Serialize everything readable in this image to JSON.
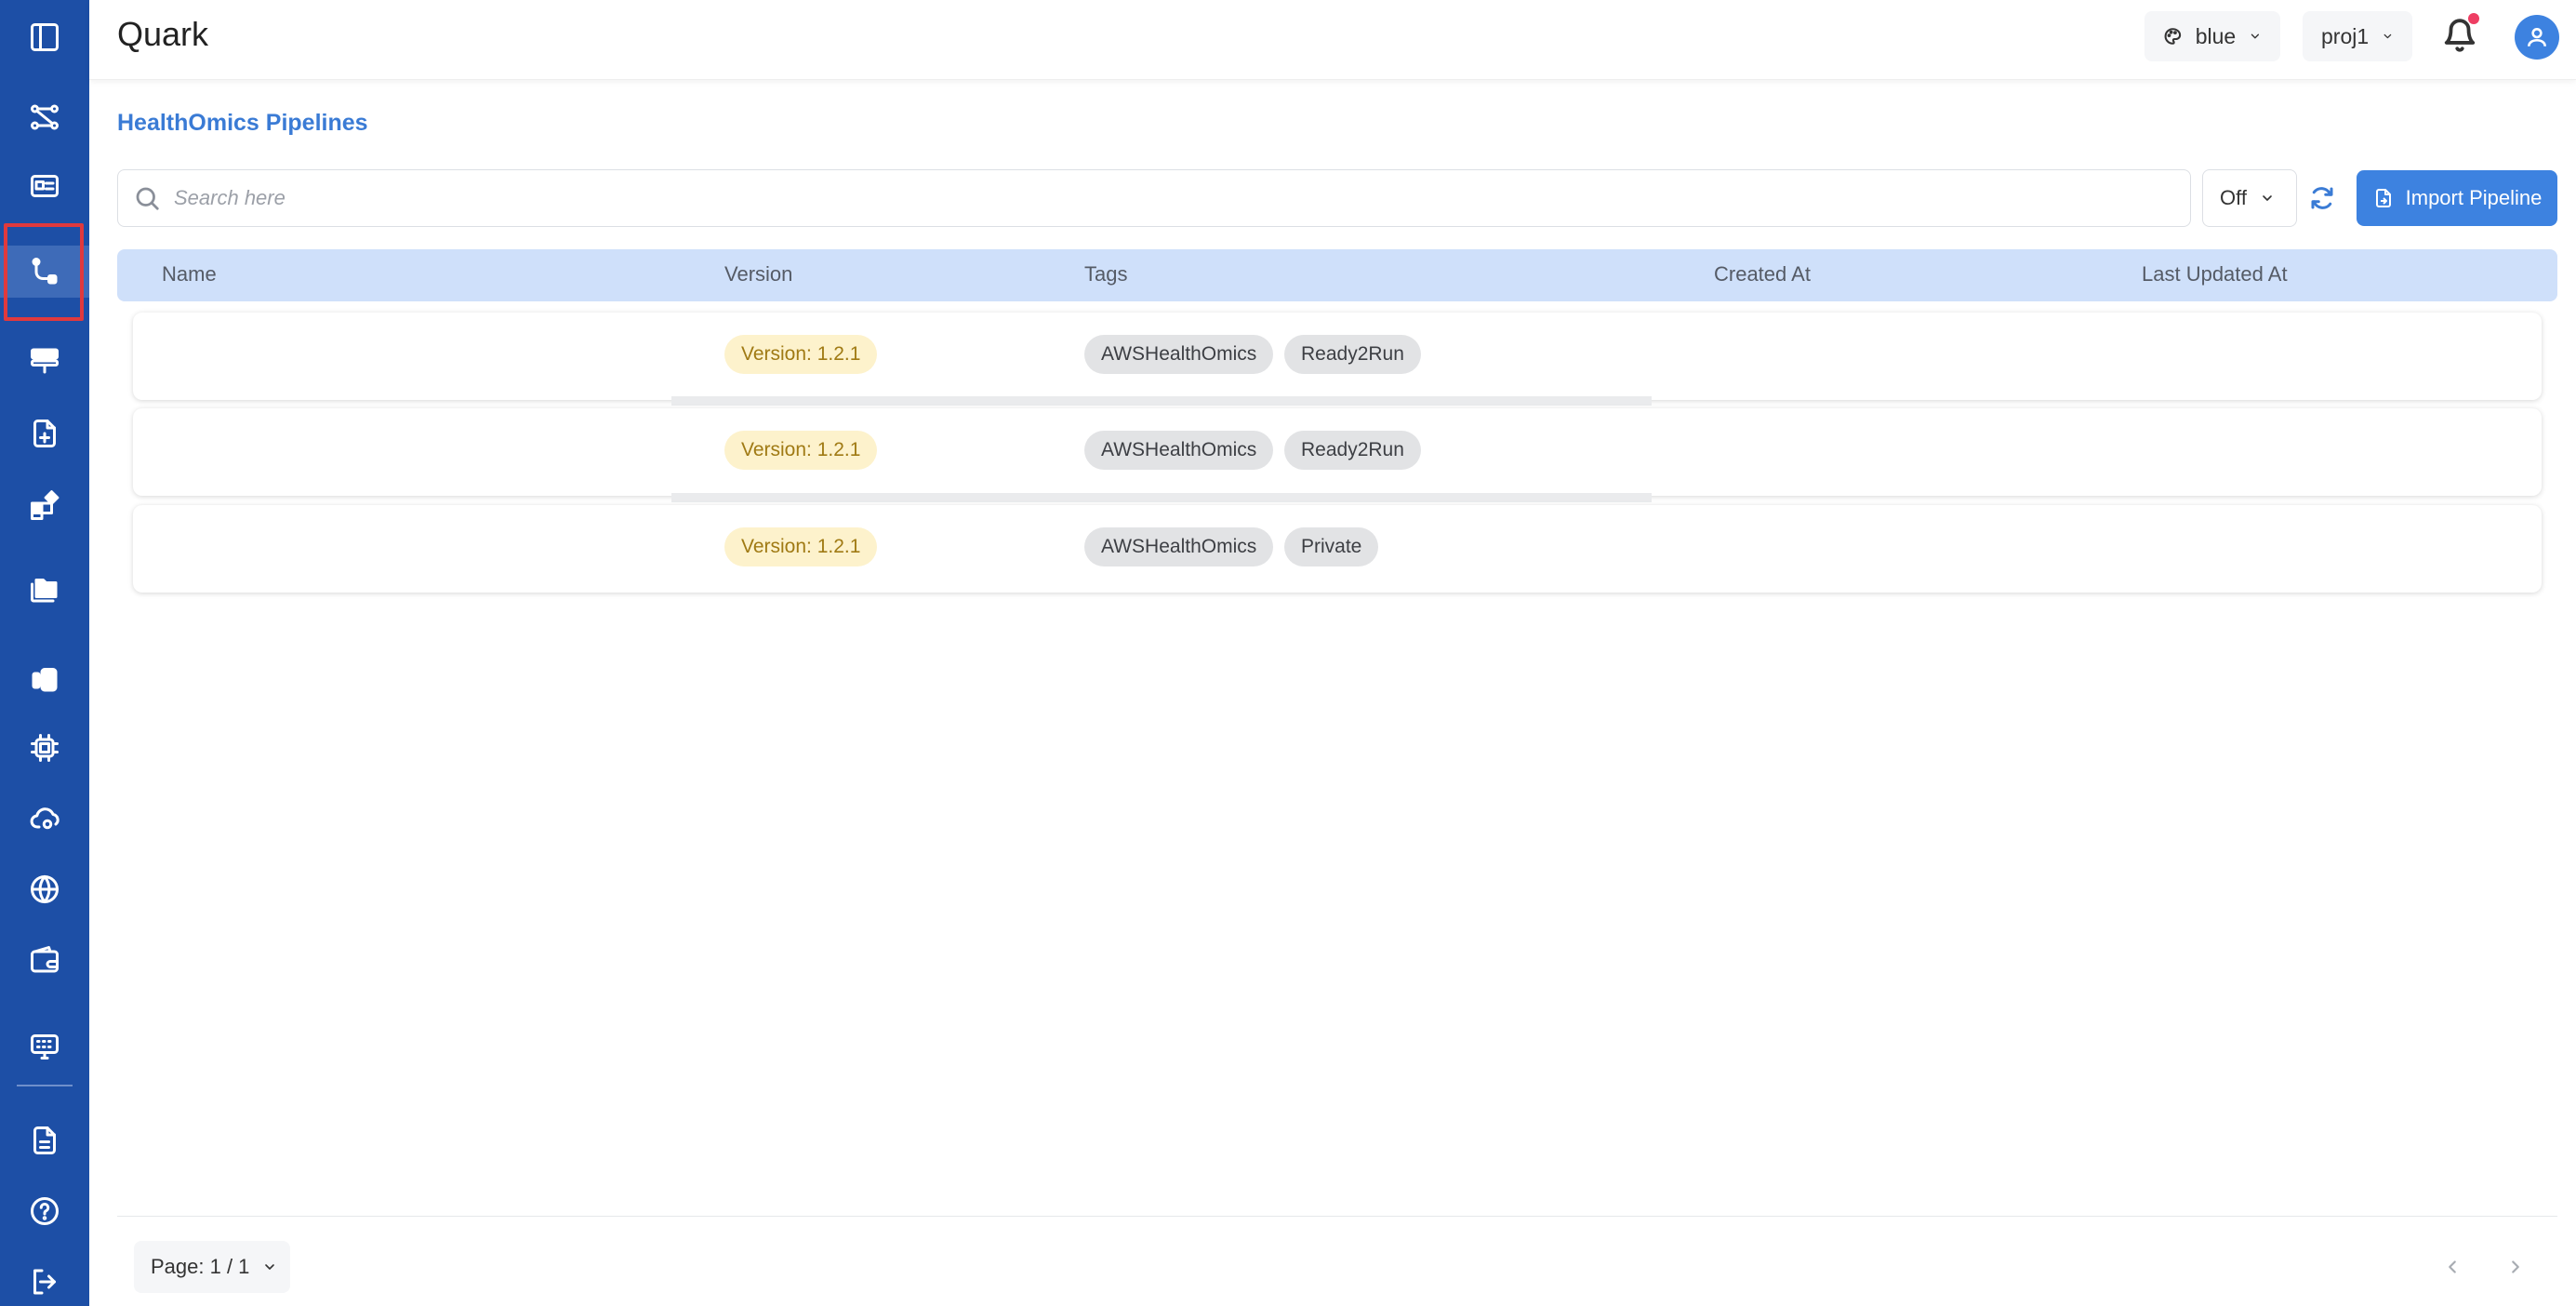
{
  "header": {
    "app_title": "Quark",
    "theme_value": "blue",
    "project_value": "proj1"
  },
  "sidebar": {
    "items": [
      {
        "icon": "sidebar-toggle-icon"
      },
      {
        "icon": "workflow-icon"
      },
      {
        "icon": "dashboard-card-icon"
      },
      {
        "icon": "pipeline-icon",
        "active": true
      },
      {
        "icon": "server-icon"
      },
      {
        "icon": "file-add-icon"
      },
      {
        "icon": "widgets-icon"
      },
      {
        "icon": "folder-icon"
      },
      {
        "icon": "storage-icon"
      },
      {
        "icon": "chip-icon"
      },
      {
        "icon": "cloud-settings-icon"
      },
      {
        "icon": "globe-icon"
      },
      {
        "icon": "wallet-icon"
      },
      {
        "icon": "keyboard-icon"
      },
      {
        "icon": "document-icon"
      },
      {
        "icon": "help-icon"
      },
      {
        "icon": "logout-icon"
      }
    ]
  },
  "page": {
    "title": "HealthOmics Pipelines"
  },
  "toolbar": {
    "search_placeholder": "Search here",
    "auto_refresh_value": "Off",
    "import_label": "Import Pipeline"
  },
  "table": {
    "columns": [
      "Name",
      "Version",
      "Tags",
      "Created At",
      "Last Updated At"
    ],
    "rows": [
      {
        "version": "Version: 1.2.1",
        "tags": [
          "AWSHealthOmics",
          "Ready2Run"
        ]
      },
      {
        "version": "Version: 1.2.1",
        "tags": [
          "AWSHealthOmics",
          "Ready2Run"
        ]
      },
      {
        "version": "Version: 1.2.1",
        "tags": [
          "AWSHealthOmics",
          "Private"
        ]
      }
    ]
  },
  "footer": {
    "page_label": "Page: 1 / 1"
  },
  "colors": {
    "sidebar_bg": "#1d4fa6",
    "accent": "#3d82e0",
    "table_header_bg": "#cfe0fa",
    "version_badge_bg": "#fdf2cc",
    "tag_bg": "#e2e3e5",
    "highlight_border": "#e0393d"
  }
}
